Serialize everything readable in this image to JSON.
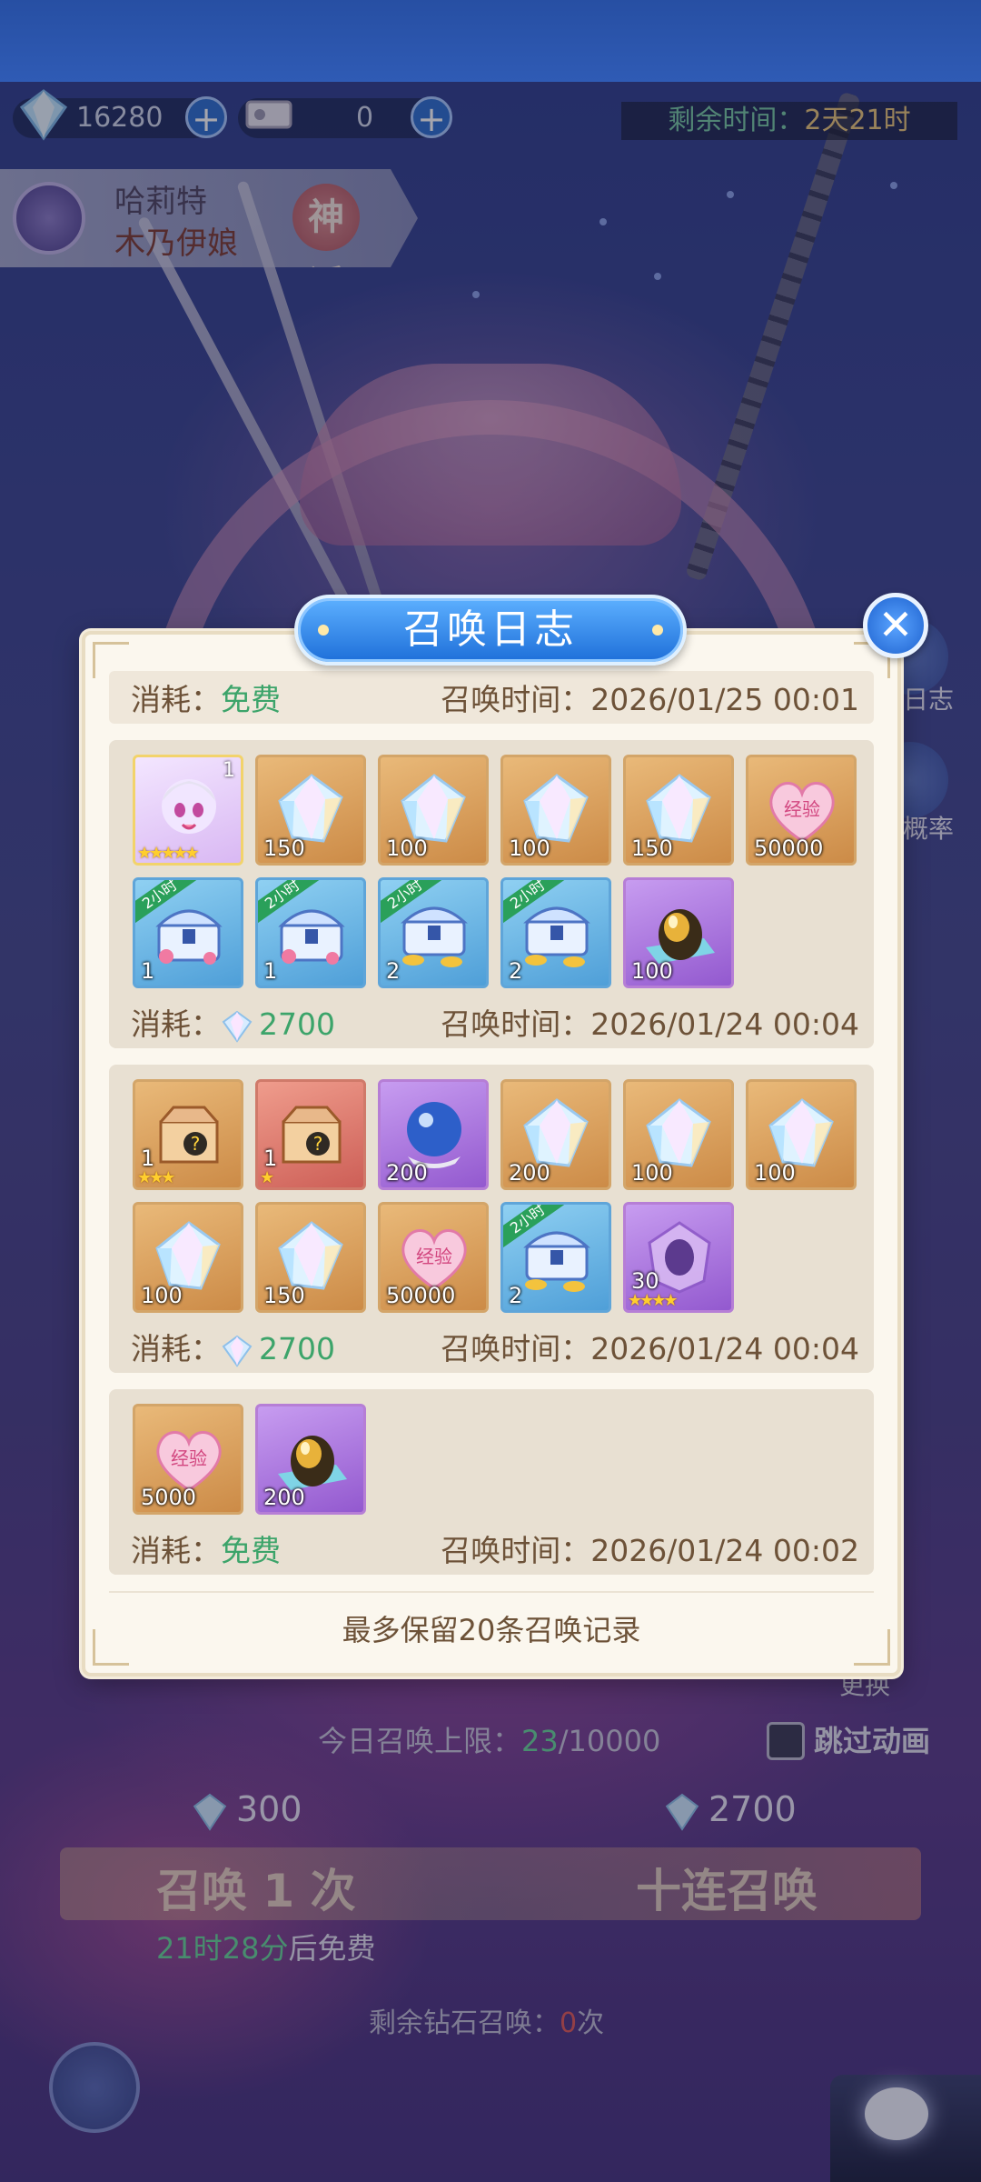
{
  "top_resources": {
    "gems": "16280",
    "tickets": "0",
    "time_left_label": "剩余时间：",
    "time_left_value": "2天21时"
  },
  "hero": {
    "name": "哈莉特",
    "subtitle": "木乃伊娘",
    "rarity": "神话"
  },
  "side": {
    "log_label": "日志",
    "rate_label": "概率",
    "exchange_label": "更换"
  },
  "dialog": {
    "title": "召唤日志",
    "close_icon": "close-icon",
    "records": [
      {
        "cost_label": "消耗：",
        "cost_value": "免费",
        "time_label": "召唤时间：",
        "time_value": "2026/01/25 00:01",
        "items": []
      },
      {
        "cost_label": "消耗：",
        "cost_value": "2700",
        "cost_icon": "gem-icon",
        "time_label": "召唤时间：",
        "time_value": "2026/01/24 00:04",
        "items": [
          {
            "kind": "hero",
            "qty": "1",
            "stars": "★★★★★",
            "icon": "hero-portrait"
          },
          {
            "kind": "gem",
            "qty": "150",
            "icon": "diamond-icon"
          },
          {
            "kind": "gem",
            "qty": "100",
            "icon": "diamond-icon"
          },
          {
            "kind": "gem",
            "qty": "100",
            "icon": "diamond-icon"
          },
          {
            "kind": "gem",
            "qty": "150",
            "icon": "diamond-icon"
          },
          {
            "kind": "exp",
            "qty": "50000",
            "icon": "exp-heart-icon",
            "label": "经验"
          },
          {
            "kind": "chest",
            "qty": "1",
            "ribbon": "2小时",
            "icon": "chest-hearts-icon"
          },
          {
            "kind": "chest",
            "qty": "1",
            "ribbon": "2小时",
            "icon": "chest-hearts-icon"
          },
          {
            "kind": "chest",
            "qty": "2",
            "ribbon": "2小时",
            "icon": "chest-gold-icon"
          },
          {
            "kind": "chest",
            "qty": "2",
            "ribbon": "2小时",
            "icon": "chest-gold-icon"
          },
          {
            "kind": "egg",
            "qty": "100",
            "icon": "golden-egg-icon"
          }
        ]
      },
      {
        "cost_label": "消耗：",
        "cost_value": "2700",
        "cost_icon": "gem-icon",
        "time_label": "召唤时间：",
        "time_value": "2026/01/24 00:04",
        "items": [
          {
            "kind": "box",
            "qty": "1",
            "stars": "★★★",
            "icon": "mystery-box-icon"
          },
          {
            "kind": "box-red",
            "qty": "1",
            "stars": "★",
            "icon": "mystery-box-icon"
          },
          {
            "kind": "orb",
            "qty": "200",
            "icon": "crystal-orb-icon"
          },
          {
            "kind": "gem",
            "qty": "200",
            "icon": "diamond-icon"
          },
          {
            "kind": "gem",
            "qty": "100",
            "icon": "diamond-icon"
          },
          {
            "kind": "gem",
            "qty": "100",
            "icon": "diamond-icon"
          },
          {
            "kind": "gem",
            "qty": "100",
            "icon": "diamond-icon"
          },
          {
            "kind": "gem",
            "qty": "150",
            "icon": "diamond-icon"
          },
          {
            "kind": "exp",
            "qty": "50000",
            "icon": "exp-heart-icon",
            "label": "经验"
          },
          {
            "kind": "chest",
            "qty": "2",
            "ribbon": "2小时",
            "icon": "chest-gold-icon"
          },
          {
            "kind": "shard",
            "qty": "30",
            "stars": "★★★★",
            "icon": "purple-shard-icon"
          }
        ]
      },
      {
        "cost_label": "消耗：",
        "cost_value": "免费",
        "time_label": "召唤时间：",
        "time_value": "2026/01/24 00:02",
        "items": [
          {
            "kind": "exp",
            "qty": "5000",
            "icon": "exp-heart-icon",
            "label": "经验"
          },
          {
            "kind": "egg",
            "qty": "200",
            "icon": "golden-egg-icon"
          }
        ]
      }
    ],
    "footer_note": "最多保留20条召唤记录"
  },
  "bottom": {
    "limit_label": "今日召唤上限：",
    "limit_used": "23",
    "limit_total": "/10000",
    "skip_label": "跳过动画",
    "single_cost": "300",
    "ten_cost": "2700",
    "single_label": "召唤 1 次",
    "ten_label": "十连召唤",
    "free_timer": "21时28分",
    "free_suffix": "后免费",
    "remain_label": "剩余钻石召唤：",
    "remain_value": "0",
    "remain_unit": "次"
  },
  "colors": {
    "accent_green": "#3ca46a",
    "dialog_bg": "#fbf7ee",
    "title_blue": "#1e6fd9",
    "text_brown": "#6d5238"
  }
}
